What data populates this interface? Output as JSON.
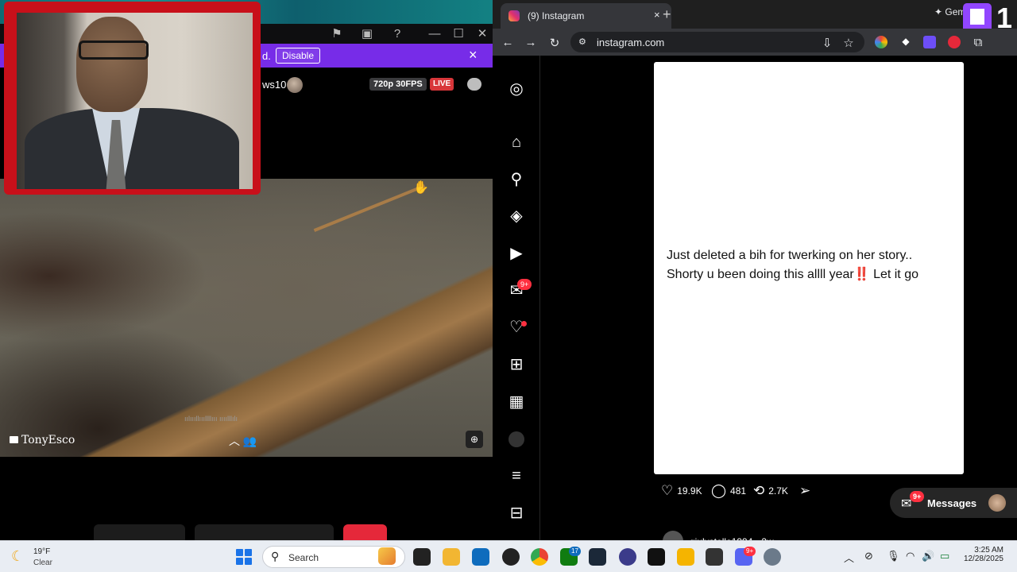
{
  "stream_app": {
    "notice_text": "d.",
    "disable_label": "Disable",
    "notice_close": "×",
    "channel_name": "ws10",
    "quality": "720p 30FPS",
    "live_label": "LIVE",
    "streamer_name": "TonyEsco",
    "hud_text": "ıılıııllıııllllııı ıııılllılı",
    "titlebar_icons": [
      "flag-icon",
      "picture-in-picture-icon",
      "help-icon",
      "minimize-icon",
      "maximize-icon",
      "close-icon"
    ]
  },
  "browser": {
    "tab_title": "(9) Instagram",
    "tab_close": "×",
    "new_tab": "+",
    "gemini_label": "✦ Gem",
    "twitch_count": "1",
    "url": "instagram.com"
  },
  "instagram": {
    "sidebar_badge": "9+",
    "post_text_line1": "Just deleted a bih for twerking on her story..",
    "post_text_line2": "Shorty u been doing this allll year‼️ Let it go",
    "likes": "19.9K",
    "comments": "481",
    "reposts": "2.7K",
    "messages_label": "Messages",
    "messages_badge": "9+",
    "next_post_user": "giulystella1994",
    "next_post_time": "• 2w"
  },
  "taskbar": {
    "temperature": "19°F",
    "condition": "Clear",
    "search_placeholder": "Search",
    "time": "3:25 AM",
    "date": "12/28/2025",
    "xbox_badge": "17",
    "discord_badge": "9+"
  },
  "colors": {
    "twitch_purple": "#772ce8",
    "live_red": "#d8363a",
    "ig_badge_red": "#ff3040",
    "webcam_border": "#c8101a"
  }
}
